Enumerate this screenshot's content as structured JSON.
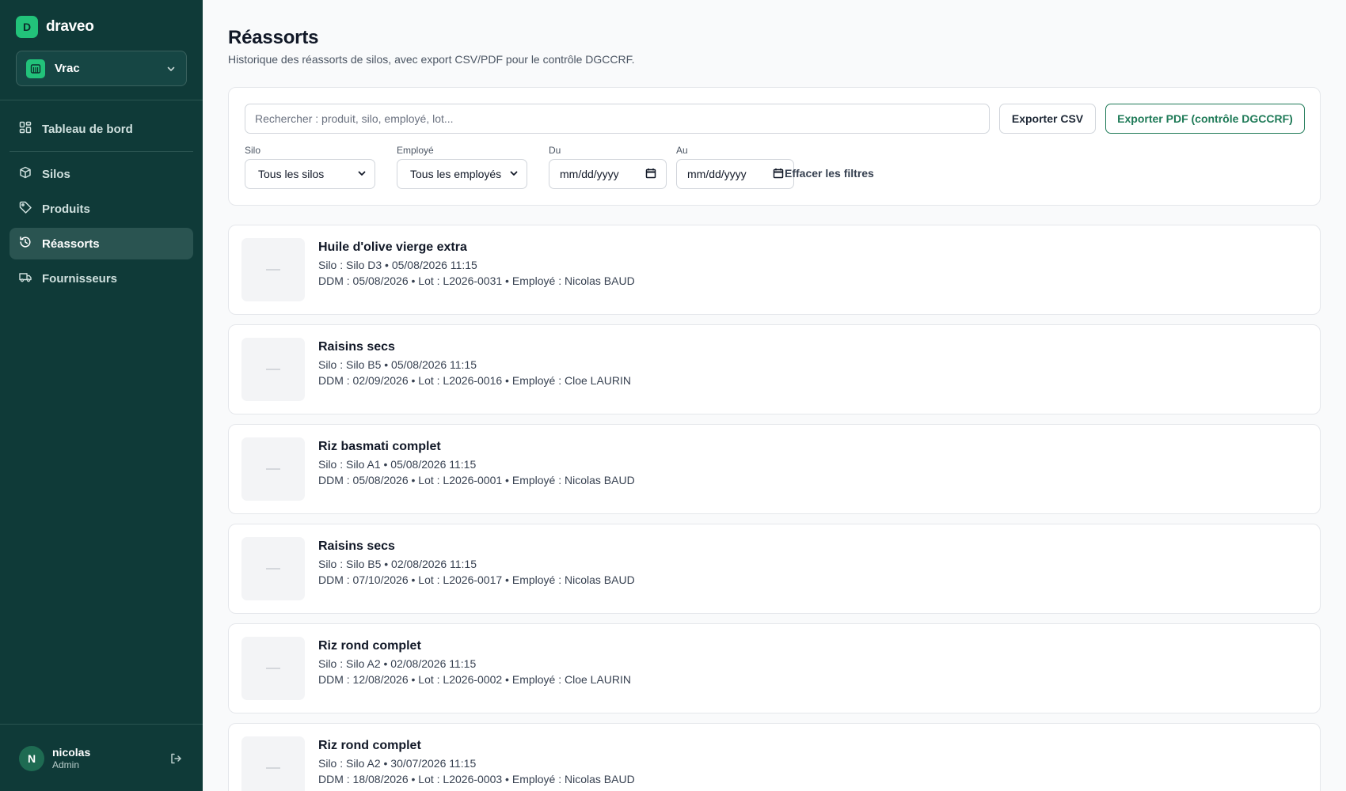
{
  "brand": {
    "mark": "D",
    "name": "draveo"
  },
  "store": {
    "name": "Vrac"
  },
  "nav": {
    "items": [
      {
        "label": "Tableau de bord",
        "icon": "dashboard-grid-icon"
      },
      {
        "label": "Silos",
        "icon": "box-icon"
      },
      {
        "label": "Produits",
        "icon": "tag-icon"
      },
      {
        "label": "Réassorts",
        "icon": "history-icon",
        "active": true
      },
      {
        "label": "Fournisseurs",
        "icon": "truck-icon"
      }
    ]
  },
  "user": {
    "initial": "N",
    "name": "nicolas",
    "role": "Admin"
  },
  "page": {
    "title": "Réassorts",
    "subtitle": "Historique des réassorts de silos, avec export CSV/PDF pour le contrôle DGCCRF."
  },
  "filters": {
    "search_placeholder": "Rechercher : produit, silo, employé, lot...",
    "export_csv": "Exporter CSV",
    "export_pdf": "Exporter PDF (contrôle DGCCRF)",
    "silo_label": "Silo",
    "silo_value": "Tous les silos",
    "employee_label": "Employé",
    "employee_value": "Tous les employés",
    "from_label": "Du",
    "from_value": "mm/dd/yyyy",
    "to_label": "Au",
    "to_value": "mm/dd/yyyy",
    "clear": "Effacer les filtres"
  },
  "restocks": [
    {
      "product": "Huile d'olive vierge extra",
      "line1": "Silo : Silo D3 • 05/08/2026 11:15",
      "line2": "DDM : 05/08/2026 • Lot : L2026-0031 • Employé : Nicolas BAUD"
    },
    {
      "product": "Raisins secs",
      "line1": "Silo : Silo B5 • 05/08/2026 11:15",
      "line2": "DDM : 02/09/2026 • Lot : L2026-0016 • Employé : Cloe LAURIN"
    },
    {
      "product": "Riz basmati complet",
      "line1": "Silo : Silo A1 • 05/08/2026 11:15",
      "line2": "DDM : 05/08/2026 • Lot : L2026-0001 • Employé : Nicolas BAUD"
    },
    {
      "product": "Raisins secs",
      "line1": "Silo : Silo B5 • 02/08/2026 11:15",
      "line2": "DDM : 07/10/2026 • Lot : L2026-0017 • Employé : Nicolas BAUD"
    },
    {
      "product": "Riz rond complet",
      "line1": "Silo : Silo A2 • 02/08/2026 11:15",
      "line2": "DDM : 12/08/2026 • Lot : L2026-0002 • Employé : Cloe LAURIN"
    },
    {
      "product": "Riz rond complet",
      "line1": "Silo : Silo A2 • 30/07/2026 11:15",
      "line2": "DDM : 18/08/2026 • Lot : L2026-0003 • Employé : Nicolas BAUD"
    }
  ],
  "colors": {
    "sidebar": "#0f3a38",
    "accent": "#22c27a",
    "pdf_button": "#1e7a57"
  }
}
